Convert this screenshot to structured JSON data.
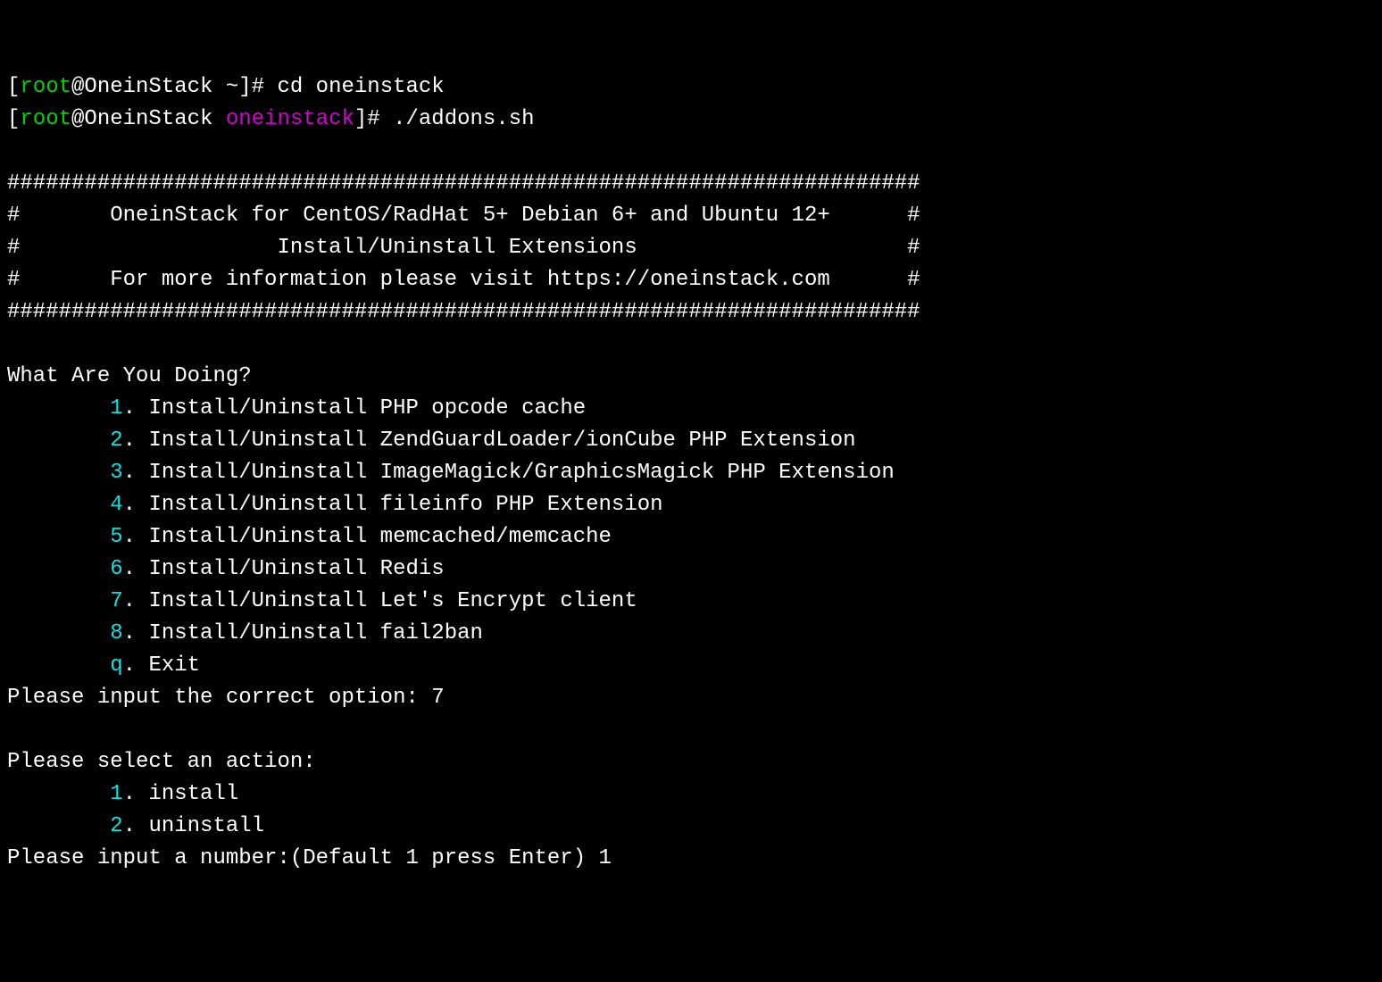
{
  "prompt1": {
    "bracket_open": "[",
    "user": "root",
    "at_host": "@OneinStack ",
    "cwd": "~",
    "bracket_close": "]# ",
    "command": "cd oneinstack"
  },
  "prompt2": {
    "bracket_open": "[",
    "user": "root",
    "at_host": "@OneinStack ",
    "cwd": "oneinstack",
    "bracket_close": "]# ",
    "command": "./addons.sh"
  },
  "banner": {
    "rule": "#######################################################################",
    "line1_open": "#       ",
    "line1_text": "OneinStack for CentOS/RadHat 5+ Debian 6+ and Ubuntu 12+",
    "line1_close": "      #",
    "line2_open": "#                    ",
    "line2_text": "Install/Uninstall Extensions",
    "line2_close": "                     #",
    "line3_open": "#       ",
    "line3_text": "For more information please visit https://oneinstack.com",
    "line3_close": "      #"
  },
  "question1": "What Are You Doing?",
  "menu1": [
    {
      "key": "1",
      "dot": ". ",
      "label": "Install/Uninstall PHP opcode cache"
    },
    {
      "key": "2",
      "dot": ". ",
      "label": "Install/Uninstall ZendGuardLoader/ionCube PHP Extension"
    },
    {
      "key": "3",
      "dot": ". ",
      "label": "Install/Uninstall ImageMagick/GraphicsMagick PHP Extension"
    },
    {
      "key": "4",
      "dot": ". ",
      "label": "Install/Uninstall fileinfo PHP Extension"
    },
    {
      "key": "5",
      "dot": ". ",
      "label": "Install/Uninstall memcached/memcache"
    },
    {
      "key": "6",
      "dot": ". ",
      "label": "Install/Uninstall Redis"
    },
    {
      "key": "7",
      "dot": ". ",
      "label": "Install/Uninstall Let's Encrypt client"
    },
    {
      "key": "8",
      "dot": ". ",
      "label": "Install/Uninstall fail2ban"
    },
    {
      "key": "q",
      "dot": ". ",
      "label": "Exit"
    }
  ],
  "prompt_option": {
    "text": "Please input the correct option: ",
    "value": "7"
  },
  "question2": "Please select an action:",
  "menu2": [
    {
      "key": "1",
      "dot": ". ",
      "label": "install"
    },
    {
      "key": "2",
      "dot": ". ",
      "label": "uninstall"
    }
  ],
  "prompt_number": {
    "text": "Please input a number:(Default 1 press Enter) ",
    "value": "1"
  },
  "menu_indent": "        "
}
